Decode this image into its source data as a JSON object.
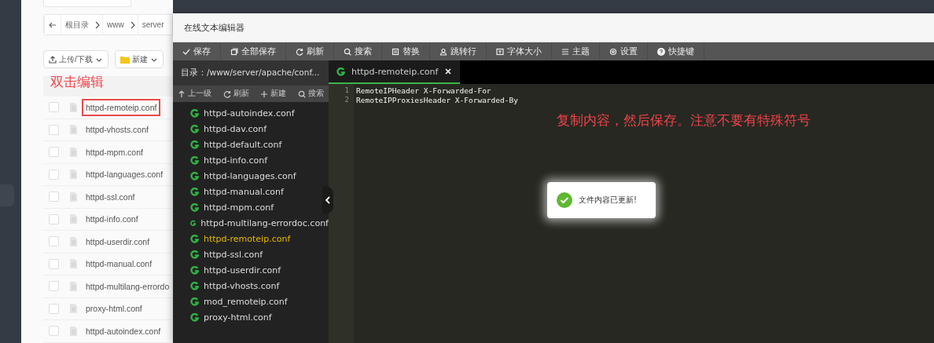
{
  "file_manager": {
    "breadcrumb": [
      "根目录",
      "www",
      "server"
    ],
    "buttons": [
      {
        "label": "上传/下载",
        "kind": "upload"
      },
      {
        "label": "新建",
        "kind": "new"
      }
    ],
    "files": [
      {
        "name": "httpd-remoteip.conf",
        "highlighted": true,
        "checked": false
      },
      {
        "name": "httpd-vhosts.conf",
        "highlighted": false,
        "checked": false
      },
      {
        "name": "httpd-mpm.conf",
        "highlighted": false,
        "checked": false
      },
      {
        "name": "httpd-languages.conf",
        "highlighted": false,
        "checked": false
      },
      {
        "name": "httpd-ssl.conf",
        "highlighted": false,
        "checked": false
      },
      {
        "name": "httpd-info.conf",
        "highlighted": false,
        "checked": false
      },
      {
        "name": "httpd-userdir.conf",
        "highlighted": false,
        "checked": false
      },
      {
        "name": "httpd-manual.conf",
        "highlighted": false,
        "checked": false
      },
      {
        "name": "httpd-multilang-errordo",
        "highlighted": false,
        "checked": false
      },
      {
        "name": "proxy-html.conf",
        "highlighted": false,
        "checked": false
      },
      {
        "name": "httpd-autoindex.conf",
        "highlighted": false,
        "checked": false
      }
    ]
  },
  "annotation": "双击编辑",
  "editor": {
    "title": "在线文本编辑器",
    "toolbar": [
      {
        "label": "保存",
        "kind": "save"
      },
      {
        "label": "全部保存",
        "kind": "save-all"
      },
      {
        "label": "刷新",
        "kind": "refresh"
      },
      {
        "label": "搜索",
        "kind": "search"
      },
      {
        "label": "替换",
        "kind": "replace"
      },
      {
        "label": "跳转行",
        "kind": "goto"
      },
      {
        "label": "字体大小",
        "kind": "font"
      },
      {
        "label": "主题",
        "kind": "theme"
      },
      {
        "label": "设置",
        "kind": "settings"
      },
      {
        "label": "快捷键",
        "kind": "help"
      }
    ],
    "sidebar": {
      "path": "目录：/www/server/apache/conf...",
      "tools": [
        {
          "label": "上一级",
          "kind": "up"
        },
        {
          "label": "刷新",
          "kind": "refresh"
        },
        {
          "label": "新建",
          "kind": "new"
        },
        {
          "label": "搜索",
          "kind": "search"
        }
      ],
      "files": [
        {
          "name": "httpd-autoindex.conf",
          "selected": false
        },
        {
          "name": "httpd-dav.conf",
          "selected": false
        },
        {
          "name": "httpd-default.conf",
          "selected": false
        },
        {
          "name": "httpd-info.conf",
          "selected": false
        },
        {
          "name": "httpd-languages.conf",
          "selected": false
        },
        {
          "name": "httpd-manual.conf",
          "selected": false
        },
        {
          "name": "httpd-mpm.conf",
          "selected": false
        },
        {
          "name": "httpd-multilang-errordoc.conf",
          "selected": false
        },
        {
          "name": "httpd-remoteip.conf",
          "selected": true
        },
        {
          "name": "httpd-ssl.conf",
          "selected": false
        },
        {
          "name": "httpd-userdir.conf",
          "selected": false
        },
        {
          "name": "httpd-vhosts.conf",
          "selected": false
        },
        {
          "name": "mod_remoteip.conf",
          "selected": false
        },
        {
          "name": "proxy-html.conf",
          "selected": false
        }
      ]
    },
    "tabs": [
      {
        "label": "httpd-remoteip.conf",
        "selected": true
      }
    ],
    "code_lines": [
      {
        "number": "1",
        "text": "RemoteIPHeader X-Forwarded-For"
      },
      {
        "number": "2",
        "text": "RemoteIPProxiesHeader X-Forwarded-By"
      }
    ],
    "note": "复制内容，然后保存。注意不要有特殊符号",
    "toast": {
      "message": "文件内容已更新!"
    }
  }
}
